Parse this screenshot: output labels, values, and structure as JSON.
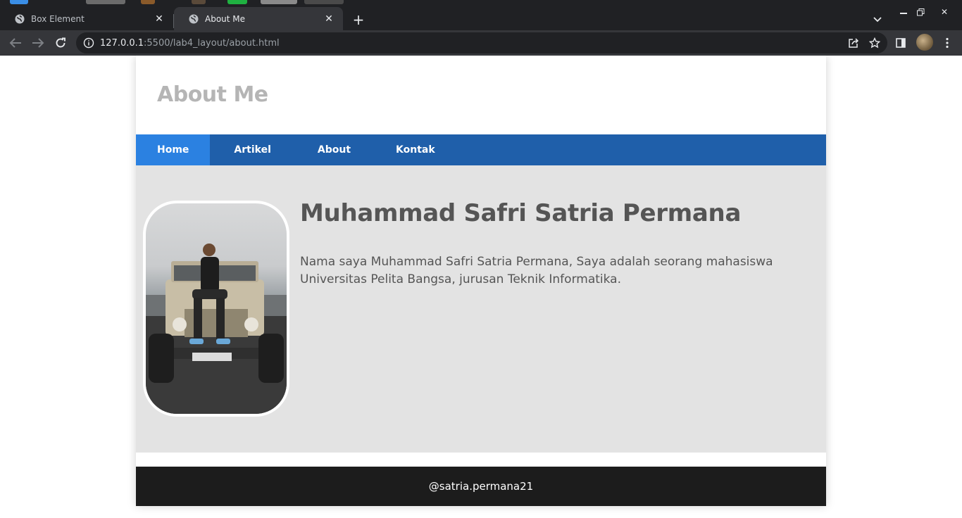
{
  "browser": {
    "tabs": [
      {
        "title": "Box Element",
        "active": false
      },
      {
        "title": "About Me",
        "active": true
      }
    ],
    "url_host": "127.0.0.1",
    "url_rest": ":5500/lab4_layout/about.html"
  },
  "page": {
    "header_title": "About Me",
    "nav": [
      {
        "label": "Home",
        "active": true
      },
      {
        "label": "Artikel",
        "active": false
      },
      {
        "label": "About",
        "active": false
      },
      {
        "label": "Kontak",
        "active": false
      }
    ],
    "profile_name": "Muhammad Safri Satria Permana",
    "bio": "Nama saya Muhammad Safri Satria Permana, Saya adalah seorang mahasiswa Universitas Pelita Bangsa, jurusan Teknik Informatika.",
    "footer_text": "@satria.permana21"
  },
  "colors": {
    "nav_bg": "#1f5faa",
    "nav_active": "#2b81e1",
    "content_bg": "#e3e3e3",
    "footer_bg": "#1c1c1c",
    "header_title": "#b5b5b5"
  }
}
